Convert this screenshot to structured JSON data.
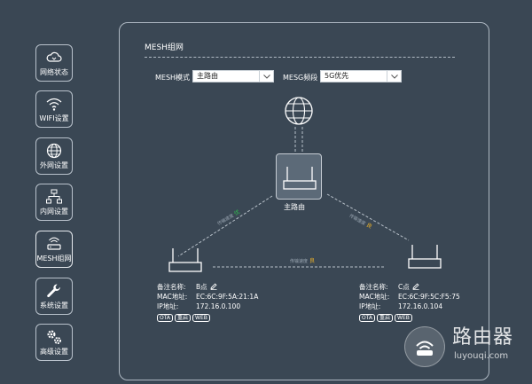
{
  "sidebar": {
    "items": [
      {
        "label": "网络状态",
        "icon": "cloud-icon"
      },
      {
        "label": "WIFI设置",
        "icon": "wifi-icon"
      },
      {
        "label": "外网设置",
        "icon": "globe-icon"
      },
      {
        "label": "内网设置",
        "icon": "lan-icon"
      },
      {
        "label": "MESH组网",
        "icon": "mesh-router-icon"
      },
      {
        "label": "系统设置",
        "icon": "wrench-icon"
      },
      {
        "label": "高级设置",
        "icon": "gears-icon"
      }
    ]
  },
  "panel": {
    "title": "MESH组网",
    "mesh_mode_label": "MESH模式",
    "mesh_mode_value": "主路由",
    "band_label": "MESG频段",
    "band_value": "5G优先"
  },
  "diagram": {
    "main_router_label": "主路由",
    "link_left": {
      "text": "传输速度",
      "grade": "优"
    },
    "link_right": {
      "text": "传输速度",
      "grade": "良"
    },
    "link_bottom": {
      "text": "传输速度",
      "grade": "良"
    },
    "colors": {
      "good": "#2fbf4f",
      "fair": "#f0b429",
      "line": "#b8c1ca"
    }
  },
  "nodes": {
    "b": {
      "name_label": "备注名称:",
      "name": "B点",
      "mac_label": "MAC地址:",
      "mac": "EC:6C:9F:5A:21:1A",
      "ip_label": "IP地址:",
      "ip": "172.16.0.100",
      "btn_ota": "OTA",
      "btn_restart": "重启",
      "btn_web": "WEB"
    },
    "c": {
      "name_label": "备注名称:",
      "name": "C点",
      "mac_label": "MAC地址:",
      "mac": "EC:6C:9F:5C:F5:75",
      "ip_label": "IP地址:",
      "ip": "172.16.0.104",
      "btn_ota": "OTA",
      "btn_restart": "重启",
      "btn_web": "WEB"
    }
  },
  "watermark": {
    "title": "路由器",
    "subtitle": "luyouqi.com"
  }
}
